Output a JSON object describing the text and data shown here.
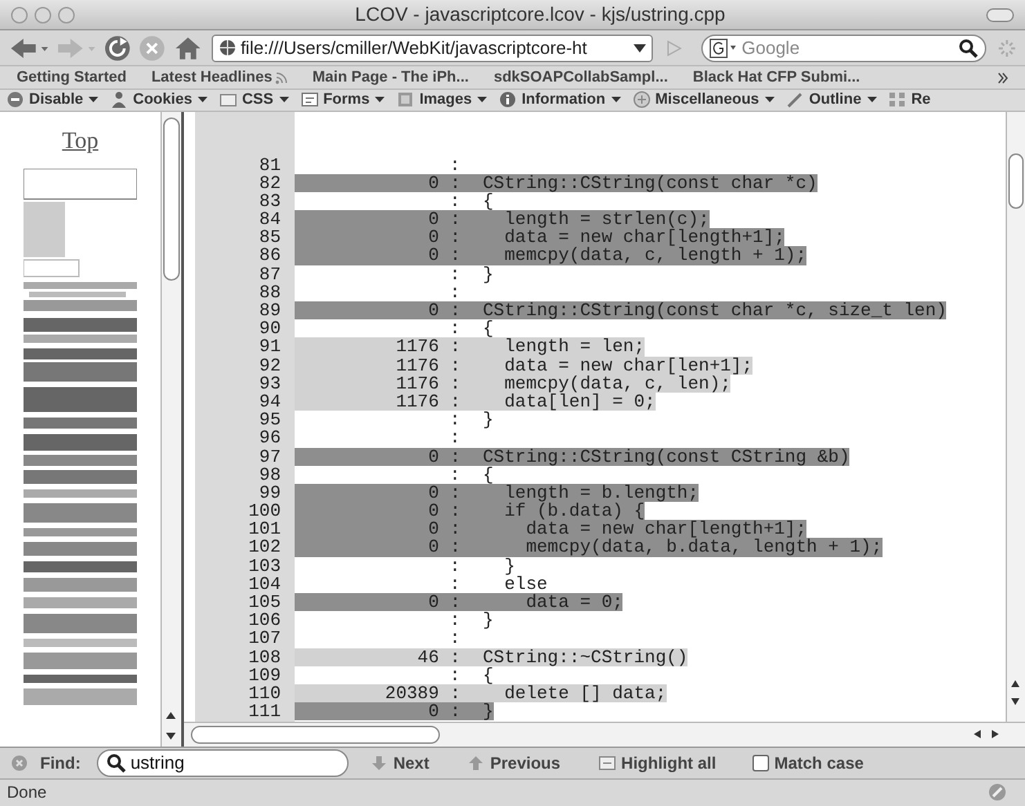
{
  "window": {
    "title": "LCOV - javascriptcore.lcov - kjs/ustring.cpp"
  },
  "nav_buttons": [
    {
      "kind": "back",
      "disabled": false
    },
    {
      "kind": "forward",
      "disabled": true
    },
    {
      "kind": "reload",
      "disabled": false
    },
    {
      "kind": "stop",
      "disabled": true
    },
    {
      "kind": "home",
      "disabled": false
    }
  ],
  "address_bar": {
    "value": "file:///Users/cmiller/WebKit/javascriptcore-ht"
  },
  "search_bar": {
    "placeholder": "Google"
  },
  "bookmarks": [
    {
      "label": "Getting Started",
      "live": false
    },
    {
      "label": "Latest Headlines",
      "live": true
    },
    {
      "label": "Main Page - The iPh...",
      "live": false
    },
    {
      "label": "sdkSOAPCollabSampl...",
      "live": false
    },
    {
      "label": "Black Hat CFP Submi...",
      "live": false
    }
  ],
  "dev_toolbar": [
    {
      "label": "Disable",
      "kind": "disable",
      "dropdown": true
    },
    {
      "label": "Cookies",
      "kind": "cookies",
      "dropdown": true
    },
    {
      "label": "CSS",
      "kind": "css",
      "dropdown": true
    },
    {
      "label": "Forms",
      "kind": "forms",
      "dropdown": true
    },
    {
      "label": "Images",
      "kind": "images",
      "dropdown": true
    },
    {
      "label": "Information",
      "kind": "information",
      "dropdown": true
    },
    {
      "label": "Miscellaneous",
      "kind": "misc",
      "dropdown": true
    },
    {
      "label": "Outline",
      "kind": "outline",
      "dropdown": true
    },
    {
      "label": "Re",
      "kind": "resize",
      "dropdown": false
    }
  ],
  "sidebar": {
    "link": "Top"
  },
  "listing": [
    {
      "line": "81",
      "separator": ":",
      "kind": "none"
    },
    {
      "line": "82",
      "count": "0",
      "separator": ":",
      "code": "CString::CString(const char *c)",
      "kind": "miss"
    },
    {
      "line": "83",
      "separator": ":",
      "code": "{",
      "kind": "none"
    },
    {
      "line": "84",
      "count": "0",
      "separator": ":",
      "code": "  length = strlen(c);",
      "kind": "miss"
    },
    {
      "line": "85",
      "count": "0",
      "separator": ":",
      "code": "  data = new char[length+1];",
      "kind": "miss"
    },
    {
      "line": "86",
      "count": "0",
      "separator": ":",
      "code": "  memcpy(data, c, length + 1);",
      "kind": "miss"
    },
    {
      "line": "87",
      "separator": ":",
      "code": "}",
      "kind": "none"
    },
    {
      "line": "88",
      "separator": ":",
      "kind": "none"
    },
    {
      "line": "89",
      "count": "0",
      "separator": ":",
      "code": "CString::CString(const char *c, size_t len)",
      "kind": "miss"
    },
    {
      "line": "90",
      "separator": ":",
      "code": "{",
      "kind": "none"
    },
    {
      "line": "91",
      "count": "1176",
      "separator": ":",
      "code": "  length = len;",
      "kind": "hit"
    },
    {
      "line": "92",
      "count": "1176",
      "separator": ":",
      "code": "  data = new char[len+1];",
      "kind": "hit"
    },
    {
      "line": "93",
      "count": "1176",
      "separator": ":",
      "code": "  memcpy(data, c, len);",
      "kind": "hit"
    },
    {
      "line": "94",
      "count": "1176",
      "separator": ":",
      "code": "  data[len] = 0;",
      "kind": "hit"
    },
    {
      "line": "95",
      "separator": ":",
      "code": "}",
      "kind": "none"
    },
    {
      "line": "96",
      "separator": ":",
      "kind": "none"
    },
    {
      "line": "97",
      "count": "0",
      "separator": ":",
      "code": "CString::CString(const CString &b)",
      "kind": "miss"
    },
    {
      "line": "98",
      "separator": ":",
      "code": "{",
      "kind": "none"
    },
    {
      "line": "99",
      "count": "0",
      "separator": ":",
      "code": "  length = b.length;",
      "kind": "miss"
    },
    {
      "line": "100",
      "count": "0",
      "separator": ":",
      "code": "  if (b.data) {",
      "kind": "miss"
    },
    {
      "line": "101",
      "count": "0",
      "separator": ":",
      "code": "    data = new char[length+1];",
      "kind": "miss"
    },
    {
      "line": "102",
      "count": "0",
      "separator": ":",
      "code": "    memcpy(data, b.data, length + 1);",
      "kind": "miss"
    },
    {
      "line": "103",
      "separator": ":",
      "code": "  }",
      "kind": "none"
    },
    {
      "line": "104",
      "separator": ":",
      "code": "  else",
      "kind": "none"
    },
    {
      "line": "105",
      "count": "0",
      "separator": ":",
      "code": "    data = 0;",
      "kind": "miss"
    },
    {
      "line": "106",
      "separator": ":",
      "code": "}",
      "kind": "none"
    },
    {
      "line": "107",
      "separator": ":",
      "kind": "none"
    },
    {
      "line": "108",
      "count": "46",
      "separator": ":",
      "code": "CString::~CString()",
      "kind": "hit"
    },
    {
      "line": "109",
      "separator": ":",
      "code": "{",
      "kind": "none"
    },
    {
      "line": "110",
      "count": "20389",
      "separator": ":",
      "code": "  delete [] data;",
      "kind": "hit"
    },
    {
      "line": "111",
      "count": "0",
      "separator": ":",
      "code": "}",
      "kind": "miss"
    }
  ],
  "find_bar": {
    "label": "Find:",
    "value": "ustring",
    "buttons": [
      {
        "label": "Next",
        "kind": "next"
      },
      {
        "label": "Previous",
        "kind": "previous"
      },
      {
        "label": "Highlight all",
        "kind": "highlight"
      }
    ],
    "match_case": {
      "label": "Match case",
      "checked": false
    }
  },
  "status_bar": {
    "text": "Done"
  }
}
